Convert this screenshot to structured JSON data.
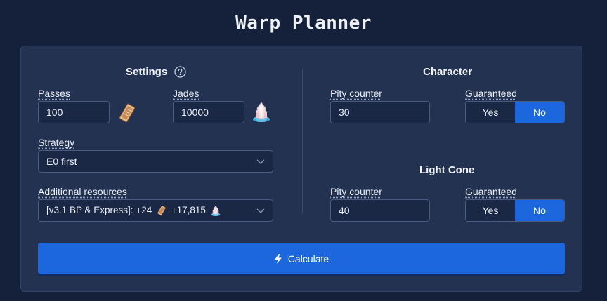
{
  "app_title": "Warp Planner",
  "settings": {
    "title": "Settings",
    "help_icon": "question-circle-icon",
    "passes": {
      "label": "Passes",
      "value": "100",
      "icon": "pass-ticket-icon"
    },
    "jades": {
      "label": "Jades",
      "value": "10000",
      "icon": "jade-crystal-icon"
    },
    "strategy": {
      "label": "Strategy",
      "value": "E0 first"
    },
    "additional_resources": {
      "label": "Additional resources",
      "value_prefix": "[v3.1 BP & Express]:",
      "passes_amount": "+24",
      "jades_amount": "+17,815"
    }
  },
  "character": {
    "title": "Character",
    "pity_label": "Pity counter",
    "pity_value": "30",
    "guaranteed_label": "Guaranteed",
    "yes_label": "Yes",
    "no_label": "No",
    "selected": "No"
  },
  "light_cone": {
    "title": "Light Cone",
    "pity_label": "Pity counter",
    "pity_value": "40",
    "guaranteed_label": "Guaranteed",
    "yes_label": "Yes",
    "no_label": "No",
    "selected": "No"
  },
  "calculate_label": "Calculate",
  "colors": {
    "background": "#15213a",
    "card": "#233251",
    "accent": "#1c67de"
  }
}
